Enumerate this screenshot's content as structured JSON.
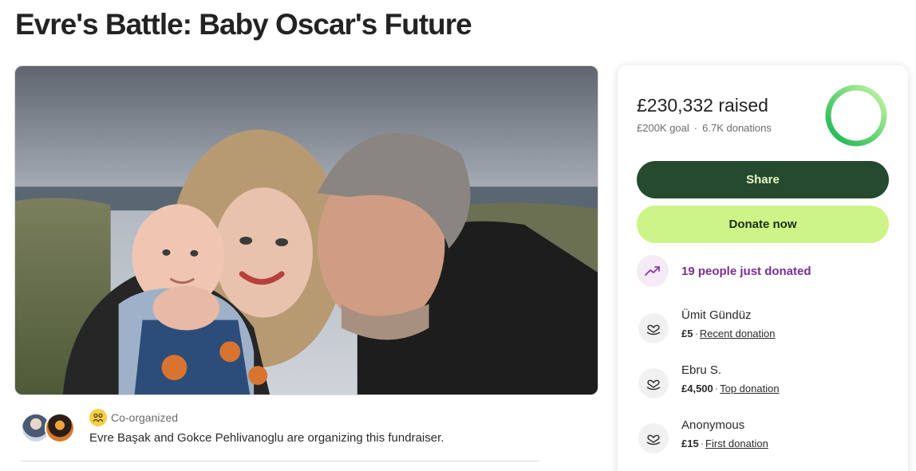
{
  "page": {
    "title": "Evre's Battle: Baby Oscar's Future"
  },
  "hero": {
    "image_alt": "family-photo"
  },
  "organizers": {
    "badge_label": "Co-organized",
    "text": "Evre Başak and Gokce Pehlivanoglu are organizing this fundraiser."
  },
  "donation_card": {
    "raised_text": "£230,332 raised",
    "goal_text": "£200K goal",
    "dot": "·",
    "donations_text": "6.7K donations",
    "progress_fraction": 1.0,
    "share_label": "Share",
    "donate_label": "Donate now",
    "trend_text": "19 people just donated",
    "donors": [
      {
        "name": "Ümit Gündüz",
        "amount": "£5",
        "tag": "Recent donation"
      },
      {
        "name": "Ebru S.",
        "amount": "£4,500",
        "tag": "Top donation"
      },
      {
        "name": "Anonymous",
        "amount": "£15",
        "tag": "First donation"
      }
    ]
  },
  "colors": {
    "share_bg": "#264a2f",
    "donate_bg": "#cdf486",
    "trend_text": "#7b2d96",
    "ring": "#1fbf5a"
  }
}
